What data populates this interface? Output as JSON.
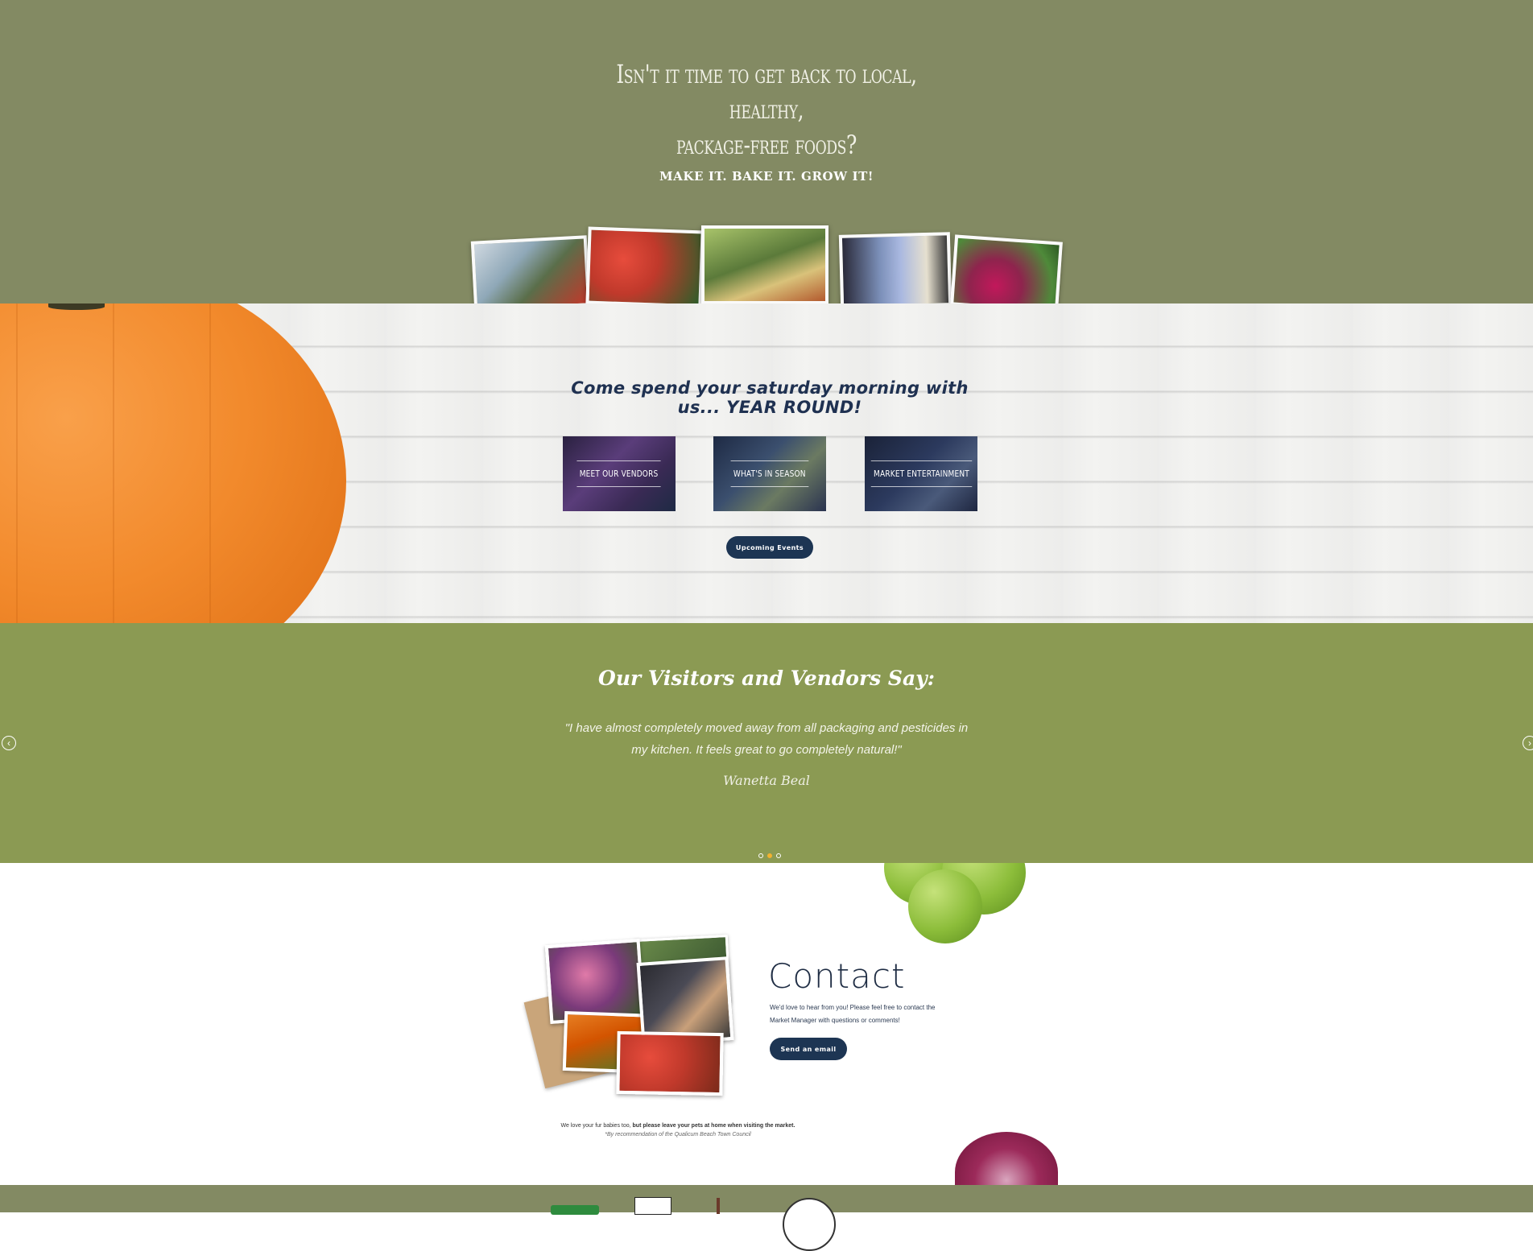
{
  "hero": {
    "title_line1": "Isn't it time to get back to local, healthy,",
    "title_line2": "package-free foods?",
    "tagline": "MAKE IT. BAKE IT. GROW IT!"
  },
  "season": {
    "heading": "Come spend your saturday morning with us... YEAR ROUND!",
    "tiles": [
      {
        "label": "Meet Our Vendors"
      },
      {
        "label": "What's in Season"
      },
      {
        "label": "Market Entertainment"
      }
    ],
    "events_button": "Upcoming Events"
  },
  "testimonials": {
    "heading": "Our Visitors and Vendors Say:",
    "quote": "\"I have almost completely moved away from all packaging and pesticides in my kitchen. It feels great to go completely natural!\"",
    "author": "Wanetta Beal",
    "prev_icon": "chevron-left-icon",
    "next_icon": "chevron-right-icon",
    "active_slide": 2,
    "slide_count": 3
  },
  "contact": {
    "title": "Contact",
    "text": "We'd love to hear from you! Please feel free to contact the Market Manager with questions or comments!",
    "button": "Send an email"
  },
  "pets_note": {
    "lead": "We love your fur babies too,",
    "bold": "but please leave your pets at home when visiting the market.",
    "footnote": "*By recommendation of the Qualicum Beach Town Council"
  },
  "colors": {
    "hero_bg": "#838a63",
    "testimonial_bg": "#8b9a53",
    "button_navy": "#1d3553",
    "active_dot": "#f2b230"
  }
}
